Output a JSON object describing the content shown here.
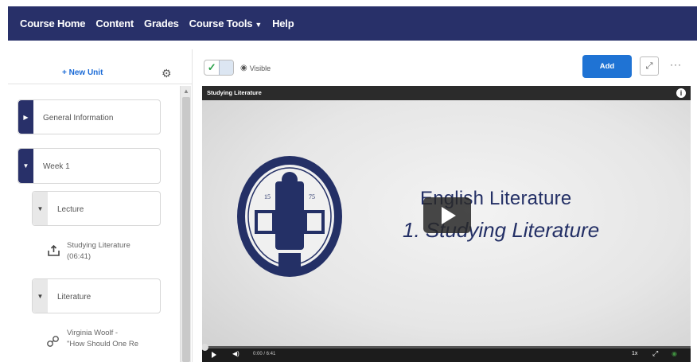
{
  "nav": {
    "items": [
      "Course Home",
      "Content",
      "Grades",
      "Course Tools",
      "Help"
    ],
    "course_tools_chevron": "⌄"
  },
  "left_panel": {
    "new_unit": "+ New Unit",
    "settings_icon": "gear-icon",
    "units": [
      {
        "label": "General Information"
      },
      {
        "label": "Week 1"
      }
    ],
    "modules": [
      {
        "label": "Lecture"
      },
      {
        "label": "Literature"
      }
    ],
    "topics": [
      {
        "label": "Studying Literature",
        "sublabel": "(06:41)",
        "icon": "video-upload-icon"
      },
      {
        "label": "Virginia Woolf -",
        "sublabel": "\"How Should One Re",
        "icon": "link-icon"
      }
    ]
  },
  "toolbar": {
    "visible_label": "Visible",
    "add_label": "Add"
  },
  "video": {
    "title": "Studying Literature",
    "heading": "English Literature",
    "subheading": "1. Studying Literature",
    "time": "0:00 / 6:41",
    "speed": "1x",
    "progress": 0
  },
  "colors": {
    "nav_bg": "#283069",
    "primary": "#1f73d4",
    "heading": "#243066"
  }
}
